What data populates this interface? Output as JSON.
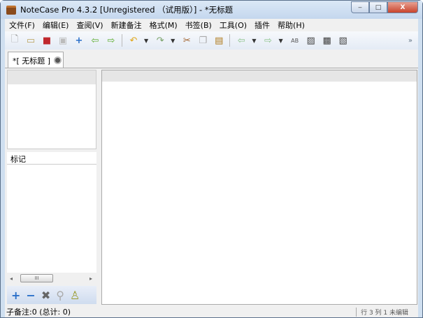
{
  "window": {
    "title": "NoteCase Pro 4.3.2 [Unregistered （试用版）] - *无标题",
    "minimize": "‒",
    "maximize": "□",
    "close": "X"
  },
  "menu": [
    "文件(F)",
    "编辑(E)",
    "查阅(V)",
    "新建备注",
    "格式(M)",
    "书签(B)",
    "工具(O)",
    "插件",
    "帮助(H)"
  ],
  "toolbar": {
    "more": "»"
  },
  "tab": {
    "label": "*[ 无标题 ]"
  },
  "left": {
    "tags_label": "标记",
    "scroll_thumb": "III",
    "scroll_left": "◂",
    "scroll_right": "▸"
  },
  "status": {
    "text": "子备注:0 (总计: 0)",
    "right": "行 3 列 1  未编辑"
  }
}
